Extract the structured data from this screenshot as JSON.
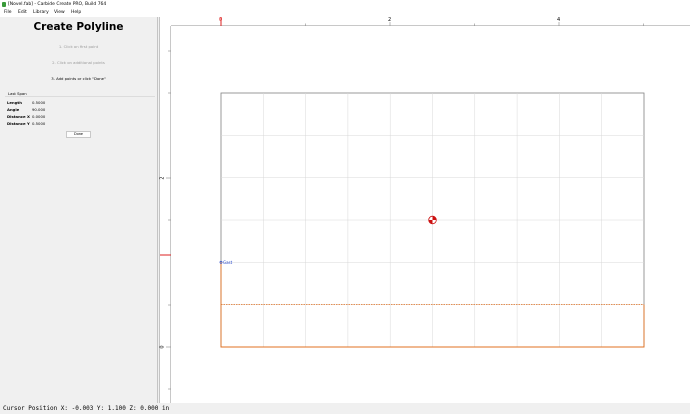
{
  "window": {
    "title": "[Novel.fab] - Carbide Create PRO, Build 764"
  },
  "menu": {
    "items": [
      "File",
      "Edit",
      "Library",
      "View",
      "Help"
    ]
  },
  "panel": {
    "title": "Create Polyline",
    "steps": [
      {
        "text": "1. Click on first point",
        "state": "done"
      },
      {
        "text": "2. Click on additional points",
        "state": "done"
      },
      {
        "text": "3. Add points or click \"Done\"",
        "state": "current"
      }
    ],
    "last_span": {
      "title": "Last Span",
      "rows": [
        {
          "label": "Length",
          "value": "0.5000"
        },
        {
          "label": "Angle",
          "value": "90.000"
        },
        {
          "label": "Distance X",
          "value": "0.0000"
        },
        {
          "label": "Distance Y",
          "value": "0.5000"
        }
      ]
    },
    "done_label": "Done"
  },
  "rulers": {
    "top_labels": [
      "0",
      "2",
      "4"
    ],
    "left_labels": [
      "2",
      "0"
    ]
  },
  "canvas": {
    "start_point_label": "Gast",
    "colors": {
      "grid": "#d8d8d8",
      "stock_border": "#808080",
      "polyline": "#e07020",
      "target_marker": "#cc1111",
      "ruler_marker": "#dd2222",
      "label": "#2a4acc"
    }
  },
  "status": {
    "cursor_text": "Cursor Position X: -0.003 Y: 1.100 Z: 0.000 in"
  }
}
